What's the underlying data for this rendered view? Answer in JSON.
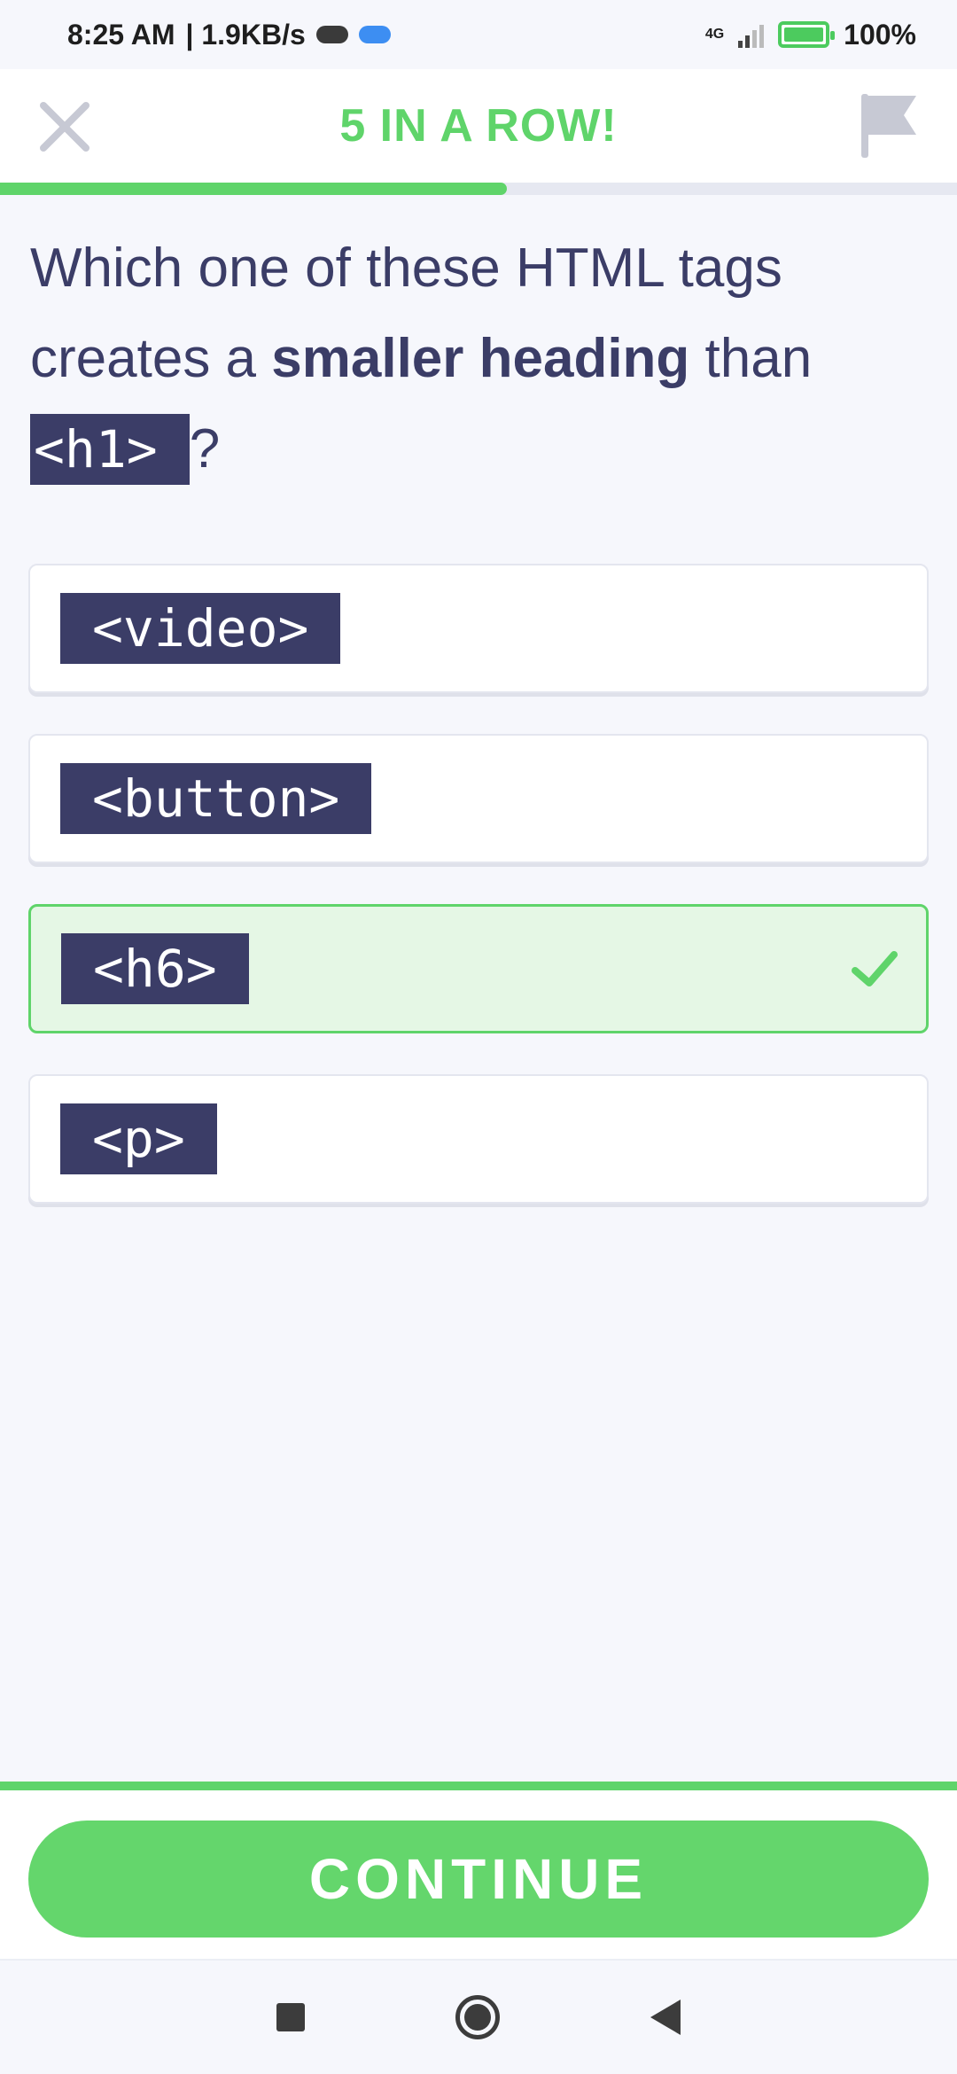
{
  "status_bar": {
    "time": "8:25 AM",
    "speed": "| 1.9KB/s",
    "network": "4G",
    "battery": "100%"
  },
  "header": {
    "streak_text": "5 IN A ROW!",
    "close_icon": "close-icon",
    "flag_icon": "flag-icon",
    "progress": 0.53
  },
  "question": {
    "part1": "Which one of these HTML tags creates a ",
    "bold": "smaller heading",
    "part2": " than ",
    "code": "<h1>",
    "end": "?"
  },
  "options": [
    {
      "label": "<video>",
      "state": "default"
    },
    {
      "label": "<button>",
      "state": "default"
    },
    {
      "label": "<h6>",
      "state": "correct"
    },
    {
      "label": "<p>",
      "state": "default"
    }
  ],
  "footer": {
    "continue_label": "CONTINUE"
  },
  "colors": {
    "accent_green": "#5fd46a",
    "text_navy": "#3b3d67",
    "correct_bg": "#e5f7e5"
  }
}
